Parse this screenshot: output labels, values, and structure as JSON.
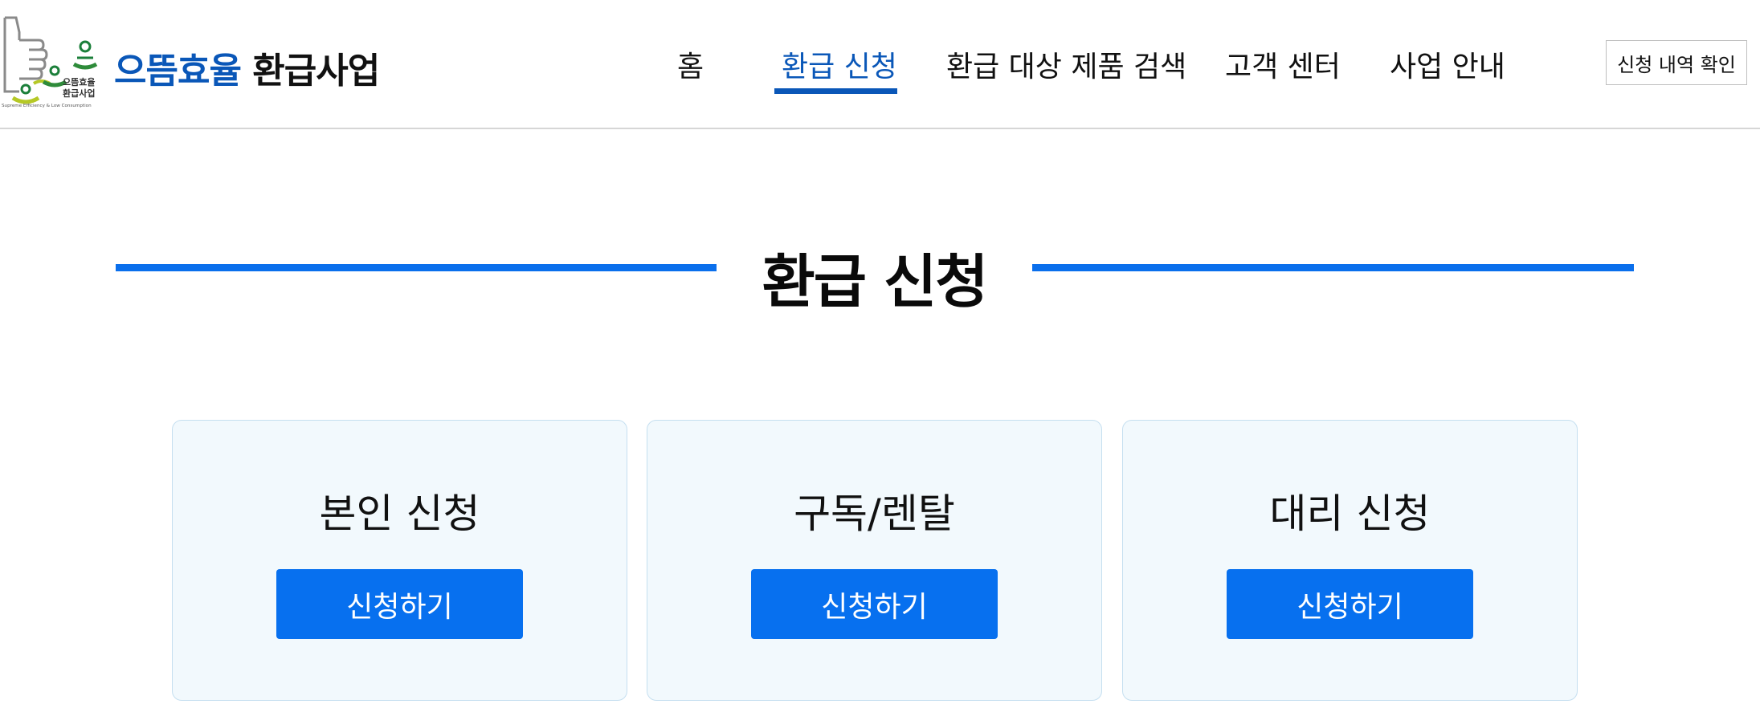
{
  "header": {
    "brand_primary": "으뜸효율",
    "brand_secondary": "환급사업",
    "logo_text_line1": "으뜸효율",
    "logo_text_line2": "환급사업",
    "logo_tagline": "Supreme Efficiency & Low Consumption",
    "nav": [
      {
        "label": "홈",
        "active": false
      },
      {
        "label": "환급 신청",
        "active": true
      },
      {
        "label": "환급 대상 제품 검색",
        "active": false
      },
      {
        "label": "고객 센터",
        "active": false
      },
      {
        "label": "사업 안내",
        "active": false
      }
    ],
    "history_button": "신청 내역 확인"
  },
  "section": {
    "title": "환급 신청"
  },
  "cards": [
    {
      "title": "본인 신청",
      "button": "신청하기"
    },
    {
      "title": "구독/렌탈",
      "button": "신청하기"
    },
    {
      "title": "대리 신청",
      "button": "신청하기"
    }
  ],
  "colors": {
    "brand_blue": "#0a57b8",
    "title_line": "#0a6fec",
    "button_blue": "#0770ef",
    "card_bg": "#f2f9fd",
    "card_border": "#c5dff0",
    "logo_green": "#2e8b3a",
    "logo_yellow": "#b5c826"
  }
}
